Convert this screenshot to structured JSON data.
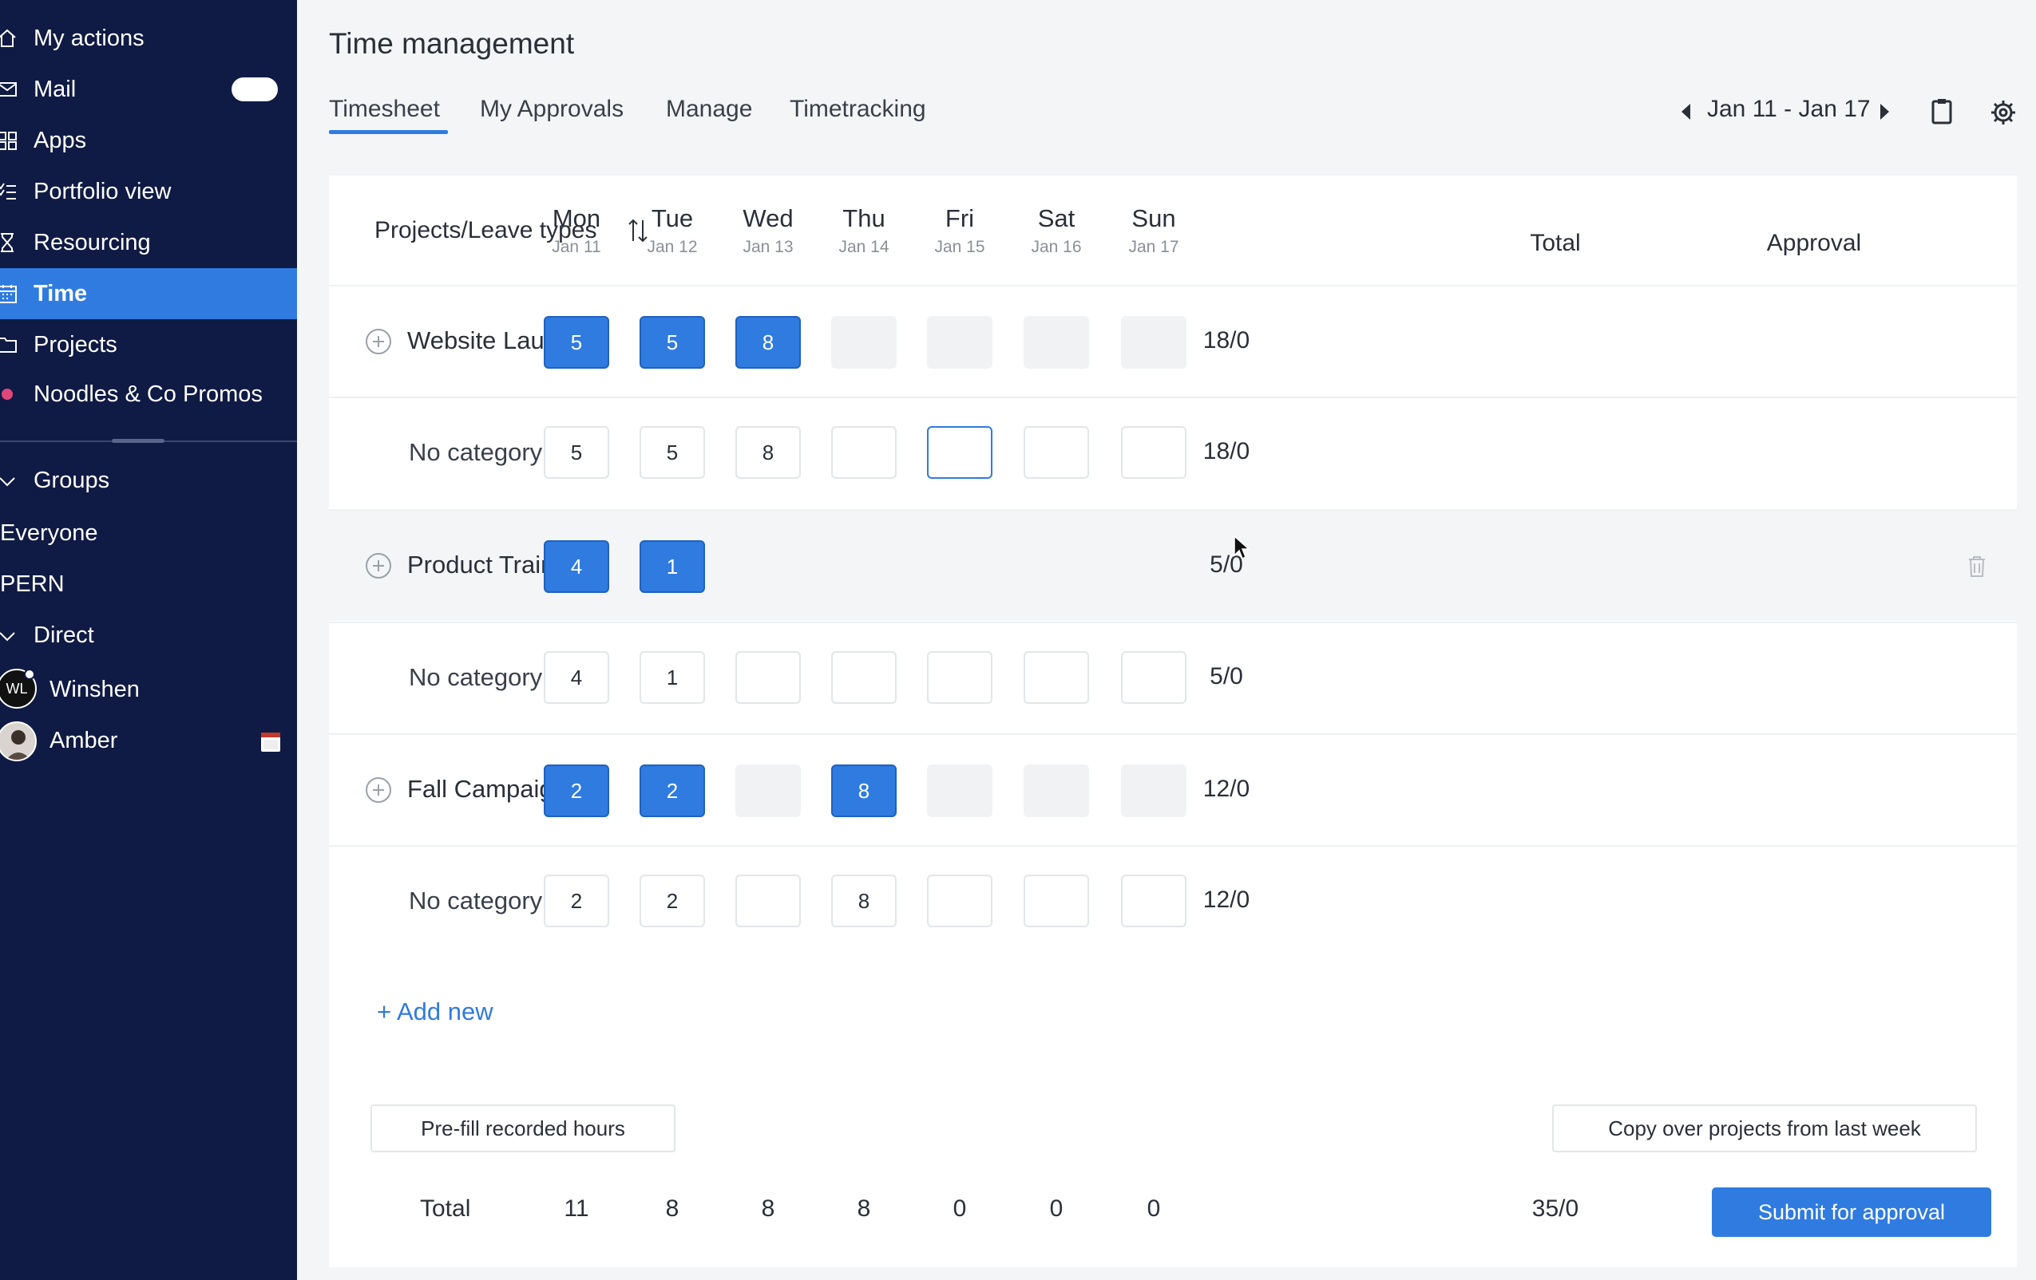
{
  "sidebar": {
    "items": [
      {
        "label": "My actions",
        "icon": "home-icon"
      },
      {
        "label": "Mail",
        "icon": "mail-icon"
      },
      {
        "label": "Apps",
        "icon": "grid-icon"
      },
      {
        "label": "Portfolio view",
        "icon": "list-check-icon"
      },
      {
        "label": "Resourcing",
        "icon": "hourglass-icon"
      },
      {
        "label": "Time",
        "icon": "calendar-icon",
        "active": true
      },
      {
        "label": "Projects",
        "icon": "folder-icon"
      },
      {
        "label": "Noodles & Co Promos",
        "icon": "dot-icon"
      }
    ],
    "groups_label": "Groups",
    "group_items": [
      "Everyone",
      "PERN"
    ],
    "direct_label": "Direct",
    "direct_items": [
      {
        "name": "Winshen",
        "initials": "WL"
      },
      {
        "name": "Amber"
      }
    ]
  },
  "header": {
    "title": "Time management",
    "tabs": [
      "Timesheet",
      "My Approvals",
      "Manage",
      "Timetracking"
    ],
    "active_tab": "Timesheet",
    "week_range": "Jan 11 - Jan 17"
  },
  "table": {
    "col_projects": "Projects/Leave types",
    "col_total": "Total",
    "col_approval": "Approval",
    "days": [
      {
        "name": "Mon",
        "date": "Jan 11"
      },
      {
        "name": "Tue",
        "date": "Jan 12"
      },
      {
        "name": "Wed",
        "date": "Jan 13"
      },
      {
        "name": "Thu",
        "date": "Jan 14"
      },
      {
        "name": "Fri",
        "date": "Jan 15"
      },
      {
        "name": "Sat",
        "date": "Jan 16"
      },
      {
        "name": "Sun",
        "date": "Jan 17"
      }
    ],
    "rows": [
      {
        "project": "Website Launch",
        "hours": [
          "5",
          "5",
          "8",
          "",
          "",
          "",
          ""
        ],
        "total": "18/0",
        "sub": "No category",
        "sub_hours": [
          "5",
          "5",
          "8",
          "",
          "",
          "",
          ""
        ],
        "sub_total": "18/0"
      },
      {
        "project": "Product Trainings",
        "hours": [
          "4",
          "1",
          "",
          "",
          "",
          "",
          ""
        ],
        "total": "5/0",
        "sub": "No category",
        "sub_hours": [
          "4",
          "1",
          "",
          "",
          "",
          "",
          ""
        ],
        "sub_total": "5/0"
      },
      {
        "project": "Fall Campaign",
        "hours": [
          "2",
          "2",
          "",
          "8",
          "",
          "",
          ""
        ],
        "total": "12/0",
        "sub": "No category",
        "sub_hours": [
          "2",
          "2",
          "",
          "8",
          "",
          "",
          ""
        ],
        "sub_total": "12/0"
      }
    ],
    "add_new": "+ Add new",
    "prefill_button": "Pre-fill recorded hours",
    "copy_button": "Copy over projects from last week",
    "total_label": "Total",
    "day_totals": [
      "11",
      "8",
      "8",
      "8",
      "0",
      "0",
      "0"
    ],
    "grand_total": "35/0",
    "submit_button": "Submit for approval"
  },
  "colors": {
    "sidebar_bg": "#0f1b44",
    "accent": "#2f7be0"
  }
}
